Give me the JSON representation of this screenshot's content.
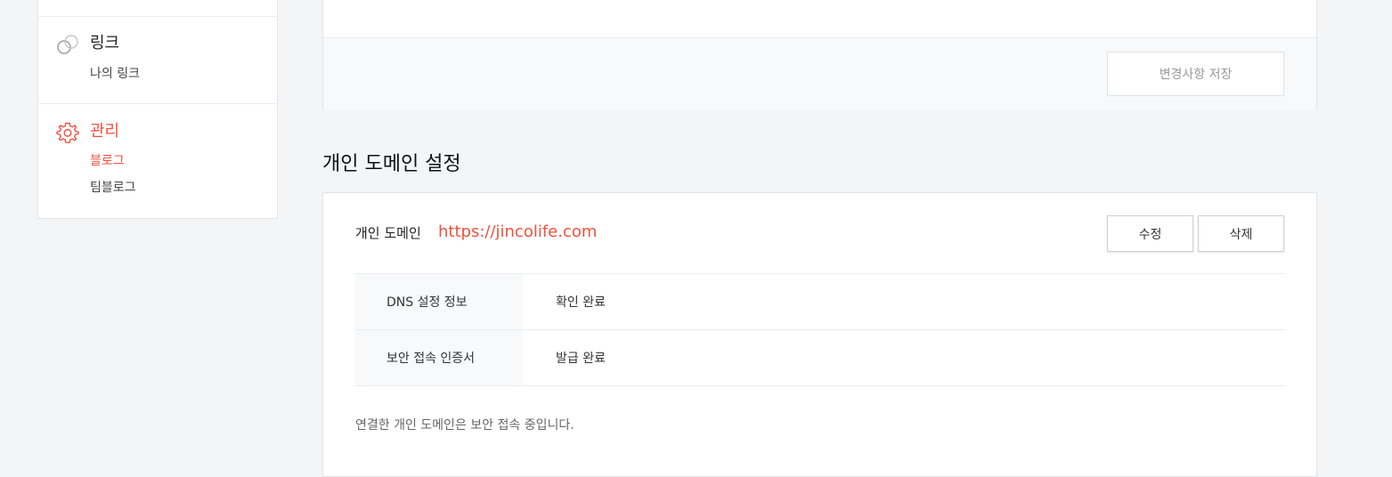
{
  "sidebar": {
    "groups": [
      {
        "title": "링크",
        "icon": "link-icon",
        "items": [
          {
            "label": "나의 링크",
            "active": false
          }
        ]
      },
      {
        "title": "관리",
        "icon": "gear-icon",
        "active": true,
        "items": [
          {
            "label": "블로그",
            "active": true
          },
          {
            "label": "팀블로그",
            "active": false
          }
        ]
      }
    ]
  },
  "top_card": {
    "save_label": "변경사항 저장"
  },
  "domain_section": {
    "title": "개인 도메인 설정",
    "domain_label": "개인 도메인",
    "domain_url": "https://jincolife.com",
    "edit_label": "수정",
    "delete_label": "삭제",
    "rows": [
      {
        "key": "DNS 설정 정보",
        "value": "확인 완료"
      },
      {
        "key": "보안 접속 인증서",
        "value": "발급 완료"
      }
    ],
    "note": "연결한 개인 도메인은 보안 접속 중입니다."
  },
  "colors": {
    "accent": "#f1503d",
    "background": "#f4f5f7",
    "card": "#ffffff",
    "table_key_bg": "#f8f9fb",
    "border": "#e3e4e8"
  }
}
